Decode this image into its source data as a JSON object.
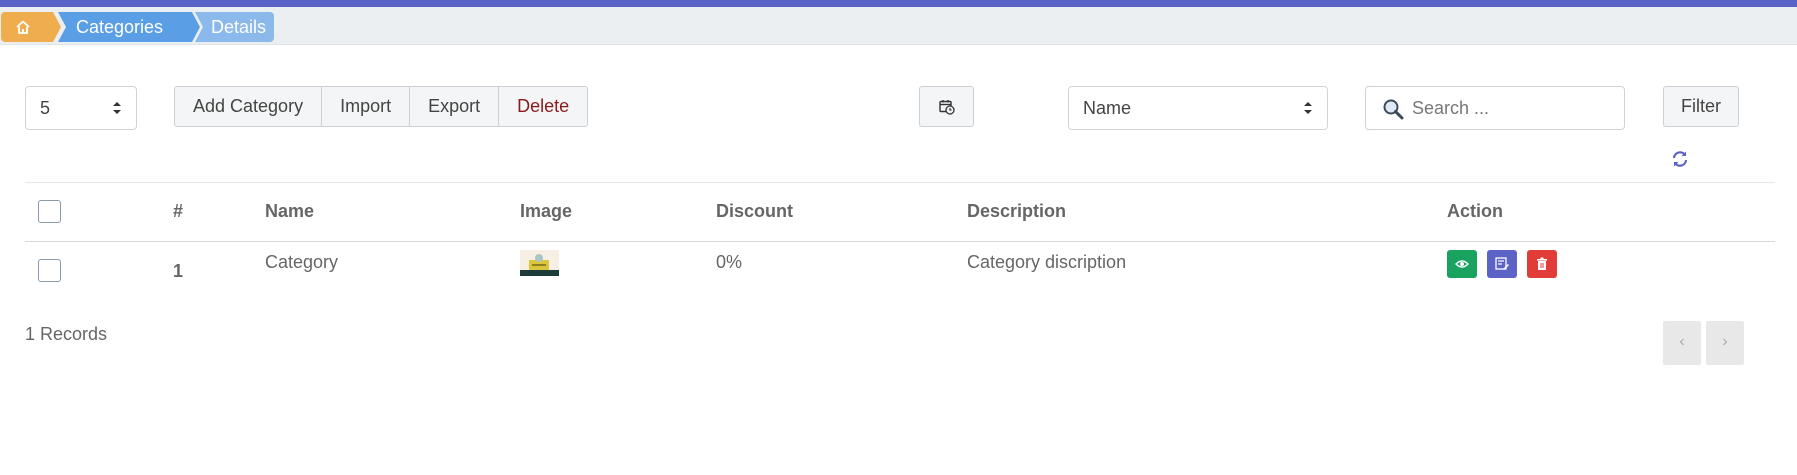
{
  "breadcrumb": {
    "home_icon": "home-icon",
    "items": [
      "Categories",
      "Details"
    ]
  },
  "toolbar": {
    "page_size": "5",
    "buttons": [
      "Add Category",
      "Import",
      "Export",
      "Delete"
    ],
    "calendar_icon": "calendar-clock-icon",
    "sort_by": "Name",
    "search_placeholder": "Search ...",
    "filter_label": "Filter",
    "refresh_icon": "refresh-icon"
  },
  "table": {
    "headers": [
      "#",
      "Name",
      "Image",
      "Discount",
      "Description",
      "Action"
    ],
    "rows": [
      {
        "index": "1",
        "name": "Category",
        "discount": "0%",
        "description": "Category discription"
      }
    ]
  },
  "actions": [
    {
      "icon": "eye-icon",
      "color": "#1aa260"
    },
    {
      "icon": "edit-icon",
      "color": "#5c63c7"
    },
    {
      "icon": "trash-icon",
      "color": "#e23c39"
    }
  ],
  "footer": {
    "records": "1 Records",
    "prev": "‹",
    "next": "›"
  },
  "colors": {
    "accent": "#5c63c7",
    "home_crumb": "#f0ad4e",
    "crumb": "#5a9fe5",
    "crumb_light": "#8cb9eb",
    "danger_text": "#8b1a1a"
  }
}
